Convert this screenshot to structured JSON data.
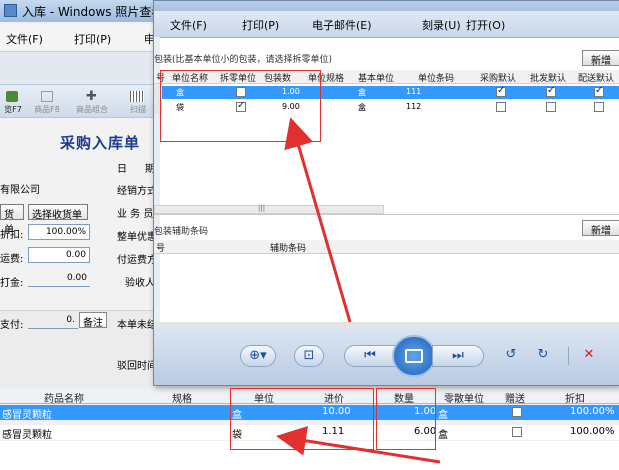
{
  "back_window": {
    "title": "入库 - Windows 照片查看",
    "menu": [
      "文件(F)",
      "打印(P)",
      "申"
    ],
    "toolbar": [
      "览F7",
      "商品F8",
      "商品组合",
      "扫描"
    ],
    "form_title": "采购入库单",
    "company": "有限公司",
    "btn_order": "货单",
    "btn_select": "选择收货单",
    "discount_label": "折扣:",
    "discount_value": "100.00%",
    "freight_label": "运费:",
    "freight_value": "0.00",
    "amount_label": "打金:",
    "amount_value": "0.00",
    "payment_label": "支付:",
    "payment_value": "0.",
    "note_tip": "备注",
    "right_labels": [
      "日",
      "期",
      "经销方式",
      "业 务 员",
      "整单优惠",
      "付运费方",
      "验收人",
      "本单未结",
      "驳回时间"
    ],
    "grid_headers": [
      "药品名称",
      "规格",
      "单位",
      "进价",
      "数量",
      "零散单位",
      "赠送",
      "折扣"
    ],
    "grid_rows": [
      {
        "name": "感冒灵颗粒",
        "unit": "盒",
        "price": "10.00",
        "qty": "1.00",
        "small_unit": "盒",
        "gift": false,
        "discount": "100.00%"
      },
      {
        "name": "感冒灵颗粒",
        "unit": "袋",
        "price": "1.11",
        "qty": "6.00",
        "small_unit": "盒",
        "gift": false,
        "discount": "100.00%"
      }
    ]
  },
  "front_window": {
    "menu": [
      "文件(F)",
      "打印(P)",
      "电子邮件(E)",
      "刻录(U)",
      "打开(O)"
    ],
    "pkg_title": "包装(比基本单位小的包装，请选择拆零单位)",
    "new_btn": "新增",
    "pkg_headers": [
      "号",
      "单位名称",
      "拆零单位",
      "包装数",
      "单位规格",
      "基本单位",
      "单位条码",
      "采购默认",
      "批发默认",
      "配送默认"
    ],
    "pkg_rows": [
      {
        "unit": "盒",
        "split": false,
        "count": "1.00",
        "base": "盒",
        "barcode": "111",
        "purchase": true,
        "wholesale": true,
        "delivery": true
      },
      {
        "unit": "袋",
        "split": true,
        "count": "9.00",
        "base": "盒",
        "barcode": "112",
        "purchase": false,
        "wholesale": false,
        "delivery": false
      }
    ],
    "aux_title": "包装辅助条码",
    "aux_new_btn": "新增",
    "aux_headers": [
      "号",
      "辅助条码"
    ],
    "scroll_marker": "|||"
  },
  "viewer_icons": [
    "zoom-icon",
    "fit-icon",
    "prev-icon",
    "slideshow-icon",
    "next-icon",
    "rotate-left-icon",
    "rotate-right-icon",
    "delete-icon"
  ],
  "annotation_color": "#e03030"
}
